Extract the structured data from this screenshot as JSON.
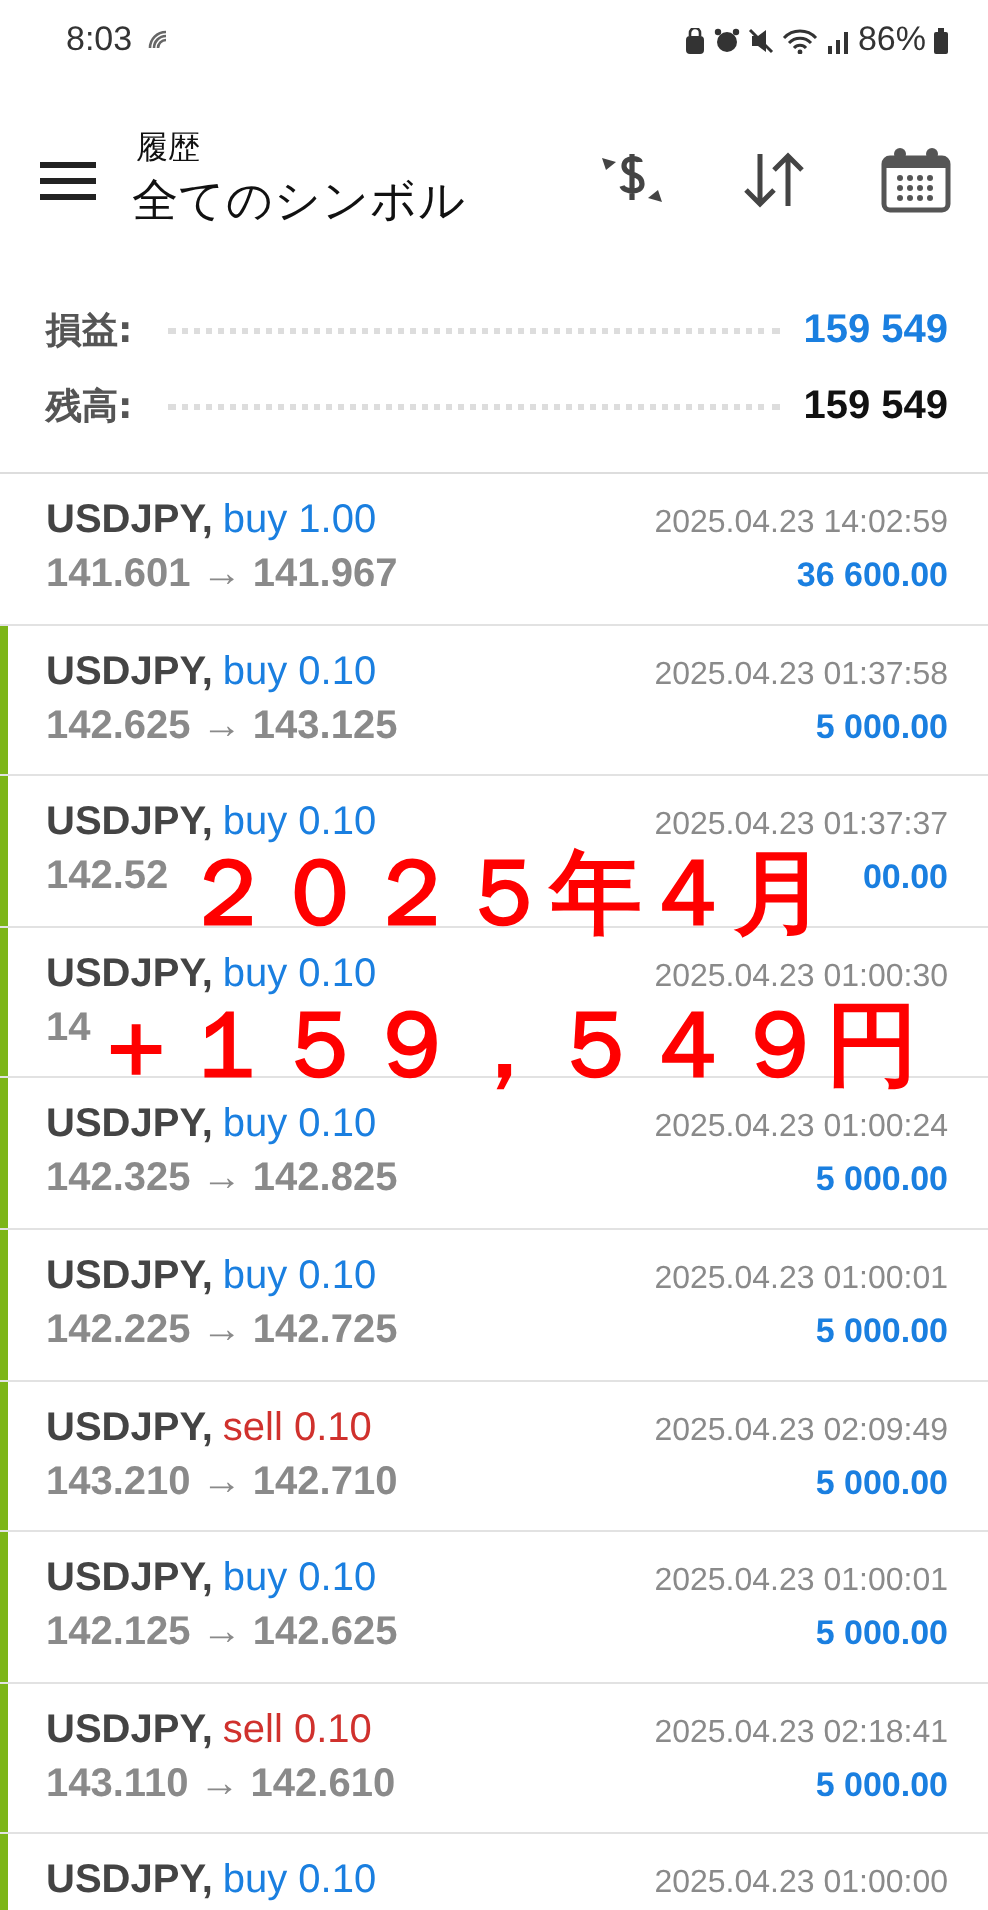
{
  "status_bar": {
    "time": "8:03",
    "battery": "86%"
  },
  "header": {
    "subtitle": "履歴",
    "title": "全てのシンボル"
  },
  "summary": [
    {
      "label": "損益:",
      "value": "159 549",
      "kind": "profit"
    },
    {
      "label": "残高:",
      "value": "159 549",
      "kind": "balance"
    }
  ],
  "deals": [
    {
      "symbol": "USDJPY,",
      "kind": "buy",
      "type": "buy 1.00",
      "time": "2025.04.23 14:02:59",
      "prices": "141.601 → 141.967",
      "profit": "36 600.00",
      "highlighted": false
    },
    {
      "symbol": "USDJPY,",
      "kind": "buy",
      "type": "buy 0.10",
      "time": "2025.04.23 01:37:58",
      "prices": "142.625 → 143.125",
      "profit": "5 000.00",
      "highlighted": true
    },
    {
      "symbol": "USDJPY,",
      "kind": "buy",
      "type": "buy 0.10",
      "time": "2025.04.23 01:37:37",
      "prices": "142.52",
      "profit": "00.00",
      "highlighted": true
    },
    {
      "symbol": "USDJPY,",
      "kind": "buy",
      "type": "buy 0.10",
      "time": "2025.04.23 01:00:30",
      "prices": "14",
      "highlighted": true
    },
    {
      "symbol": "USDJPY,",
      "kind": "buy",
      "type": "buy 0.10",
      "time": "2025.04.23 01:00:24",
      "prices": "142.325 → 142.825",
      "profit": "5 000.00",
      "highlighted": true
    },
    {
      "symbol": "USDJPY,",
      "kind": "buy",
      "type": "buy 0.10",
      "time": "2025.04.23 01:00:01",
      "prices": "142.225 → 142.725",
      "profit": "5 000.00",
      "highlighted": true
    },
    {
      "symbol": "USDJPY,",
      "kind": "sell",
      "type": "sell 0.10",
      "time": "2025.04.23 02:09:49",
      "prices": "143.210 → 142.710",
      "profit": "5 000.00",
      "highlighted": true
    },
    {
      "symbol": "USDJPY,",
      "kind": "buy",
      "type": "buy 0.10",
      "time": "2025.04.23 01:00:01",
      "prices": "142.125 → 142.625",
      "profit": "5 000.00",
      "highlighted": true
    },
    {
      "symbol": "USDJPY,",
      "kind": "sell",
      "type": "sell 0.10",
      "time": "2025.04.23 02:18:41",
      "prices": "143.110 → 142.610",
      "profit": "5 000.00",
      "highlighted": true
    },
    {
      "symbol": "USDJPY,",
      "kind": "buy",
      "type": "buy 0.10",
      "time": "2025.04.23 01:00:00",
      "highlighted": true
    }
  ],
  "overlay": [
    "２０２５年４月",
    "＋１５９，５４９円"
  ]
}
